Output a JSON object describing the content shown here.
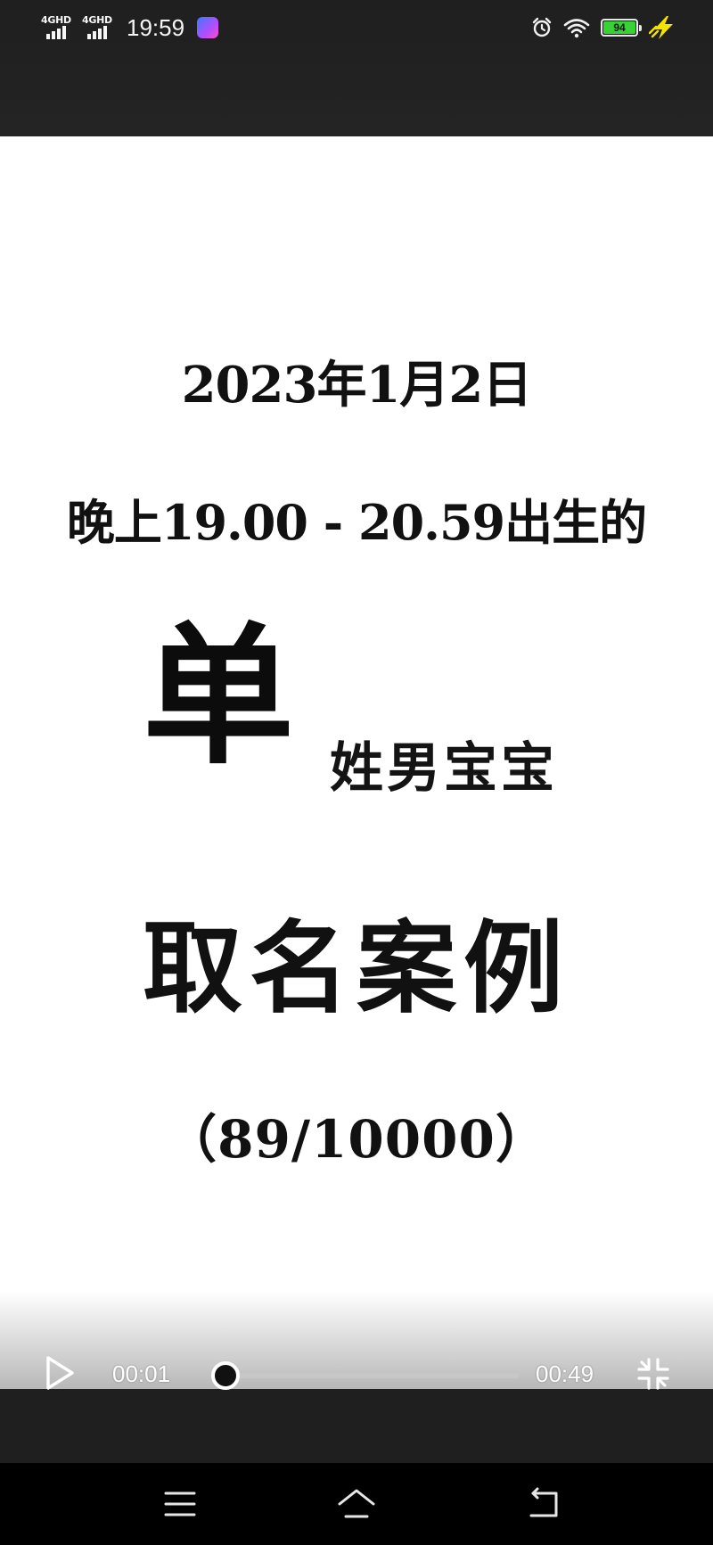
{
  "status_bar": {
    "network_1": "4GHD",
    "network_2": "4GHD",
    "time": "19:59",
    "battery": "94",
    "icons": [
      "alarm-icon",
      "wifi-icon",
      "battery-icon",
      "charging-icon"
    ]
  },
  "video": {
    "date_line": "2023年1月2日",
    "time_line": "晚上19.00 - 20.59出生的",
    "surname_big": "单",
    "gender_line": "姓男宝宝",
    "title_line": "取名案例",
    "count_line": "（89/10000）"
  },
  "player": {
    "current_time": "00:01",
    "total_time": "00:49",
    "progress_fraction": 0.02,
    "icons": [
      "play-icon",
      "exit-fullscreen-icon"
    ]
  },
  "nav_bar": {
    "icons": [
      "menu-icon",
      "home-icon",
      "back-icon"
    ]
  },
  "colors": {
    "battery_fill": "#36d236",
    "charging_bolt": "#f5e300",
    "video_background": "#ffffff",
    "text": "#111111"
  }
}
